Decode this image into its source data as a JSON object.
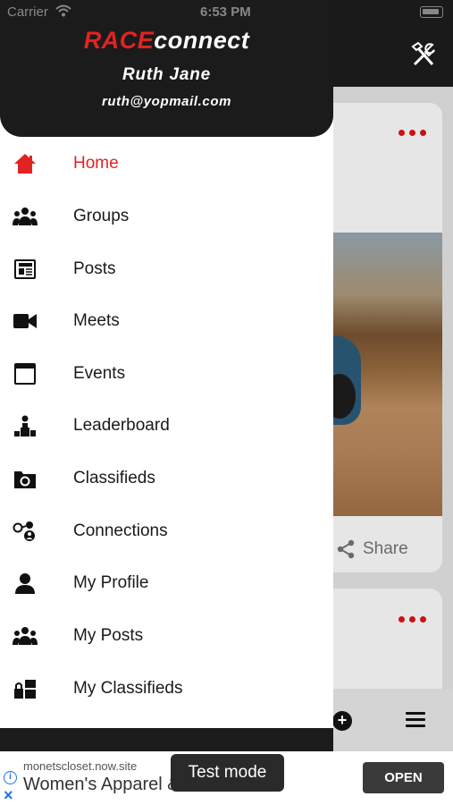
{
  "status_bar": {
    "carrier": "Carrier",
    "time": "6:53 PM"
  },
  "drawer": {
    "logo_race": "RACE",
    "logo_connect": "connect",
    "user_name": "Ruth Jane",
    "user_email": "ruth@yopmail.com",
    "items": [
      {
        "label": "Home",
        "icon": "home-icon",
        "active": true
      },
      {
        "label": "Groups",
        "icon": "groups-icon"
      },
      {
        "label": "Posts",
        "icon": "newspaper-icon"
      },
      {
        "label": "Meets",
        "icon": "video-camera-icon"
      },
      {
        "label": "Events",
        "icon": "calendar-window-icon"
      },
      {
        "label": "Leaderboard",
        "icon": "podium-icon"
      },
      {
        "label": "Classifieds",
        "icon": "folder-icon"
      },
      {
        "label": "Connections",
        "icon": "connections-icon"
      },
      {
        "label": "My Profile",
        "icon": "person-icon"
      },
      {
        "label": "My Posts",
        "icon": "groups-icon"
      },
      {
        "label": "My Classifieds",
        "icon": "my-classifieds-icon"
      }
    ],
    "accent_color": "#e32222"
  },
  "background": {
    "share_label": "Share",
    "icons": [
      "tools-icon",
      "more-dots-icon",
      "share-icon",
      "add-circle-icon",
      "hamburger-menu-icon"
    ]
  },
  "ad": {
    "domain": "monetscloset.now.site",
    "title": "Women's Apparel & Accessories",
    "open_label": "OPEN",
    "test_mode_label": "Test mode"
  }
}
